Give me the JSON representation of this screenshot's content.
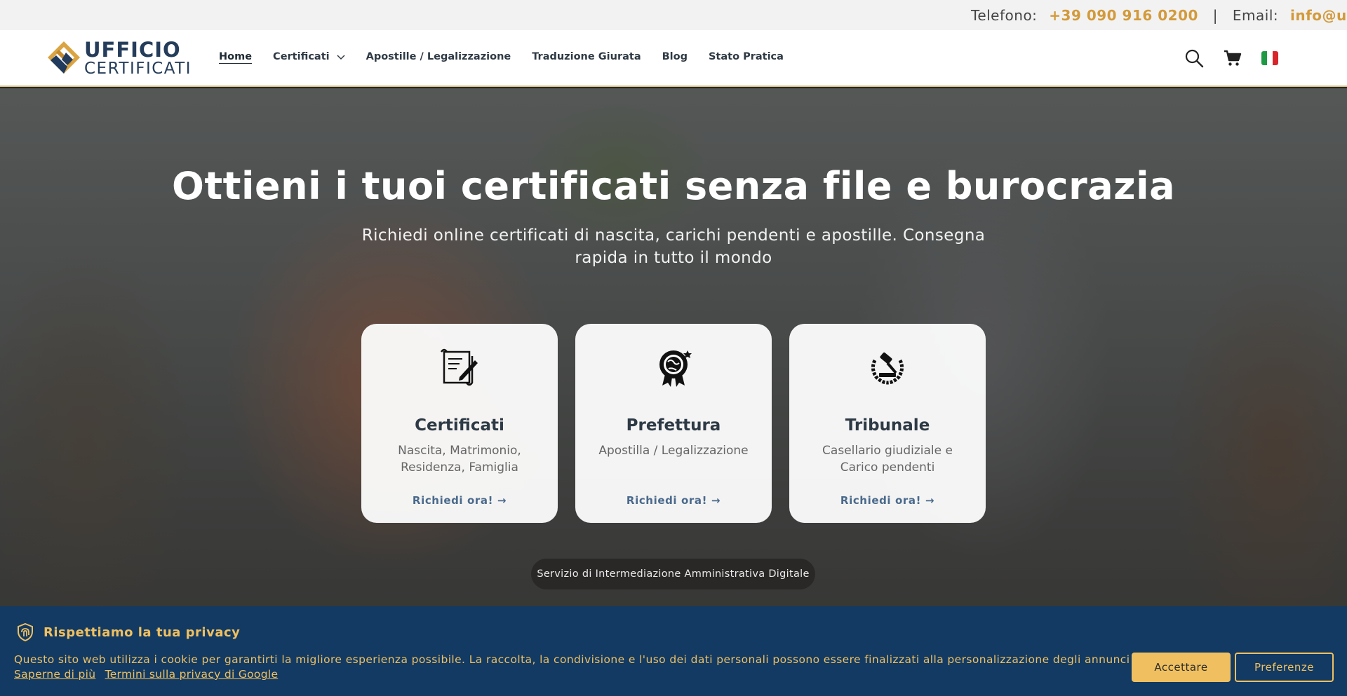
{
  "topbar": {
    "phone_label": "Telefono:",
    "phone_value": "+39 090 916 0200",
    "separator": "|",
    "email_label": "Email:",
    "email_value": "info@ufficiocertificati.it"
  },
  "logo": {
    "line1": "UFFICIO",
    "line2": "CERTIFICATI"
  },
  "nav": {
    "items": [
      {
        "label": "Home",
        "active": true
      },
      {
        "label": "Certificati",
        "dropdown": true
      },
      {
        "label": "Apostille / Legalizzazione"
      },
      {
        "label": "Traduzione Giurata"
      },
      {
        "label": "Blog"
      },
      {
        "label": "Stato Pratica"
      }
    ]
  },
  "header_icons": [
    "search-icon",
    "cart-icon",
    "italian-flag-icon"
  ],
  "hero": {
    "title": "Ottieni i tuoi certificati senza file e burocrazia",
    "subtitle": "Richiedi online certificati di nascita, carichi pendenti e apostille. Consegna rapida in tutto il mondo",
    "cards": [
      {
        "icon": "certificate-scroll-icon",
        "title": "Certificati",
        "desc": "Nascita, Matrimonio, Residenza, Famiglia",
        "link": "Richiedi ora! →"
      },
      {
        "icon": "globe-award-icon",
        "title": "Prefettura",
        "desc": "Apostilla / Legalizzazione",
        "link": "Richiedi ora! →"
      },
      {
        "icon": "gavel-laurel-icon",
        "title": "Tribunale",
        "desc": "Casellario giudiziale e Carico pendenti",
        "link": "Richiedi ora! →"
      }
    ],
    "pill": "Servizio di Intermediazione Amministrativa Digitale"
  },
  "cookie": {
    "title": "Rispettiamo la tua privacy",
    "text": "Questo sito web utilizza i cookie per garantirti la migliore esperienza possibile. La raccolta, la condivisione e l'uso dei dati personali possono essere finalizzati alla personalizzazione degli annunci pubblicitari.",
    "link1": "Saperne di più",
    "link2": "Termini sulla privacy di Google",
    "accept": "Accettare",
    "preferences": "Preferenze"
  },
  "colors": {
    "accent_gold": "#d39a3b",
    "banner_blue": "#123a63",
    "banner_gold": "#f0c060",
    "link_blue": "#4a6a8c"
  }
}
